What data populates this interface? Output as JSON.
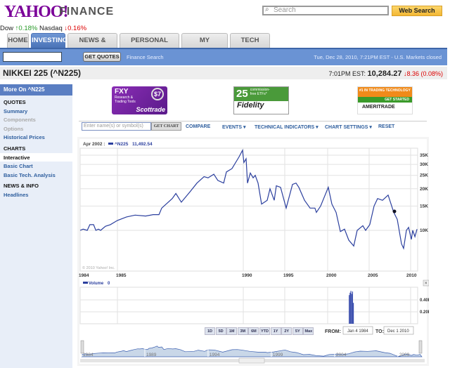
{
  "header": {
    "logo": "YAHOO!",
    "logo_suffix": "FINANCE",
    "search_placeholder": "Search",
    "web_search": "Web Search"
  },
  "ticker": {
    "dow_label": "Dow",
    "dow_change": "0.18%",
    "nasdaq_label": "Nasdaq",
    "nasdaq_change": "0.16%"
  },
  "tabs": [
    "HOME",
    "INVESTING",
    "NEWS & OPINION",
    "PERSONAL FINANCE",
    "MY PORTFOLIOS",
    "TECH TICKER"
  ],
  "quotebar": {
    "get_quotes": "GET QUOTES",
    "finance_search": "Finance Search",
    "market_status": "Tue, Dec 28, 2010, 7:21PM EST - U.S. Markets closed"
  },
  "quote": {
    "title": "NIKKEI 225 (^N225)",
    "time": "7:01PM EST:",
    "price": "10,284.27",
    "change": "8.36 (0.08%)"
  },
  "sidebar": {
    "header": "More On ^N225",
    "quotes": "QUOTES",
    "summary": "Summary",
    "components": "Components",
    "options": "Options",
    "historical": "Historical Prices",
    "charts": "CHARTS",
    "interactive": "Interactive",
    "basic_chart": "Basic Chart",
    "basic_tech": "Basic Tech. Analysis",
    "news": "NEWS & INFO",
    "headlines": "Headlines"
  },
  "ads": {
    "scottrade": [
      "FXY",
      "Research & Trading Tools",
      "Scottrade",
      "$7"
    ],
    "fidelity": [
      "25",
      "commission-free ETFs*",
      "Fidelity"
    ],
    "ameritrade": [
      "#1 IN TRADING TECHNOLOGY",
      "GET STARTED",
      "AMERITRADE"
    ]
  },
  "toolbar": {
    "placeholder": "Enter name(s) or symbol(s)",
    "get_chart": "GET CHART",
    "compare": "COMPARE",
    "events": "EVENTS ▾",
    "indicators": "TECHNICAL INDICATORS ▾",
    "settings": "CHART SETTINGS ▾",
    "reset": "RESET"
  },
  "chart_data": {
    "type": "line",
    "legend_date": "Apr 2002 :",
    "series_name": "^N225",
    "legend_value": "11,492.54",
    "copyright": "© 2010 Yahoo! Inc.",
    "yscale": "log",
    "ylim": [
      6000,
      42000
    ],
    "yticks": [
      {
        "v": 35000,
        "l": "35K"
      },
      {
        "v": 30000,
        "l": "30K"
      },
      {
        "v": 25000,
        "l": "25K"
      },
      {
        "v": 20000,
        "l": "20K"
      },
      {
        "v": 15000,
        "l": "15K"
      },
      {
        "v": 10000,
        "l": "10K"
      }
    ],
    "xticks": [
      1984,
      1985,
      1990,
      1995,
      2000,
      2005,
      2010
    ],
    "points": [
      [
        1984.0,
        10000
      ],
      [
        1984.08,
        10200
      ],
      [
        1984.19,
        10000
      ],
      [
        1984.26,
        11000
      ],
      [
        1984.36,
        11000
      ],
      [
        1984.42,
        10000
      ],
      [
        1984.49,
        10200
      ],
      [
        1984.55,
        10000
      ],
      [
        1984.68,
        10700
      ],
      [
        1984.81,
        11000
      ],
      [
        1985.0,
        11800
      ],
      [
        1985.36,
        12500
      ],
      [
        1985.7,
        12900
      ],
      [
        1986.12,
        12700
      ],
      [
        1986.42,
        13000
      ],
      [
        1986.65,
        13000
      ],
      [
        1986.76,
        14500
      ],
      [
        1987.18,
        17000
      ],
      [
        1987.32,
        18500
      ],
      [
        1987.54,
        16000
      ],
      [
        1987.88,
        19000
      ],
      [
        1988.16,
        22000
      ],
      [
        1988.44,
        24500
      ],
      [
        1988.6,
        24000
      ],
      [
        1988.83,
        25500
      ],
      [
        1988.99,
        23000
      ],
      [
        1989.22,
        22000
      ],
      [
        1989.33,
        26500
      ],
      [
        1989.55,
        28000
      ],
      [
        1989.83,
        34000
      ],
      [
        1989.97,
        38000
      ],
      [
        1990.08,
        31000
      ],
      [
        1990.34,
        33000
      ],
      [
        1990.51,
        22000
      ],
      [
        1990.85,
        26000
      ],
      [
        1991.19,
        24000
      ],
      [
        1991.44,
        25000
      ],
      [
        1991.78,
        22000
      ],
      [
        1992.2,
        15500
      ],
      [
        1992.88,
        16500
      ],
      [
        1993.22,
        20000
      ],
      [
        1993.73,
        16500
      ],
      [
        1993.98,
        21000
      ],
      [
        1994.49,
        20500
      ],
      [
        1995.16,
        14500
      ],
      [
        1995.9,
        21500
      ],
      [
        1996.31,
        22000
      ],
      [
        1996.64,
        20500
      ],
      [
        1997.3,
        16500
      ],
      [
        1997.95,
        14500
      ],
      [
        1998.52,
        14500
      ],
      [
        1998.69,
        13500
      ],
      [
        1999.18,
        15000
      ],
      [
        2000.08,
        20500
      ],
      [
        2000.51,
        15500
      ],
      [
        2001.02,
        13500
      ],
      [
        2001.53,
        9800
      ],
      [
        2002.03,
        10200
      ],
      [
        2002.54,
        8500
      ],
      [
        2003.14,
        7700
      ],
      [
        2003.56,
        10000
      ],
      [
        2004.24,
        10800
      ],
      [
        2004.58,
        10000
      ],
      [
        2005.08,
        11000
      ],
      [
        2005.59,
        15000
      ],
      [
        2006.02,
        17000
      ],
      [
        2006.61,
        16500
      ],
      [
        2007.29,
        18000
      ],
      [
        2007.97,
        13500
      ],
      [
        2008.39,
        12000
      ],
      [
        2008.9,
        8000
      ],
      [
        2009.15,
        7400
      ],
      [
        2009.49,
        10000
      ],
      [
        2009.75,
        10500
      ],
      [
        2010.08,
        8600
      ],
      [
        2010.25,
        10000
      ],
      [
        2010.51,
        9000
      ],
      [
        2010.76,
        10200
      ]
    ],
    "volume": {
      "label": "Volume",
      "value": "0",
      "yticks": [
        {
          "v": 0.4,
          "l": "0.40B"
        },
        {
          "v": 0.2,
          "l": "0.20B"
        }
      ],
      "bars": [
        [
          2002.55,
          0.48
        ],
        [
          2002.65,
          0.52
        ],
        [
          2002.75,
          0.55
        ],
        [
          2002.85,
          0.5
        ],
        [
          2002.95,
          0.54
        ],
        [
          2003.05,
          0.35
        ]
      ]
    },
    "ranges": [
      "1D",
      "5D",
      "1M",
      "3M",
      "6M",
      "YTD",
      "1Y",
      "2Y",
      "5Y",
      "Max"
    ],
    "from_label": "FROM:",
    "from": "Jan 4 1984",
    "to_label": "TO:",
    "to": "Dec 1 2010",
    "navigator_labels": [
      "1984",
      "1989",
      "1994",
      "1999",
      "2004",
      "2009"
    ]
  },
  "colors": {
    "accent": "#6a93d4",
    "line": "#2b3f9e",
    "up": "#2a9a2a",
    "down": "#dd0000"
  }
}
